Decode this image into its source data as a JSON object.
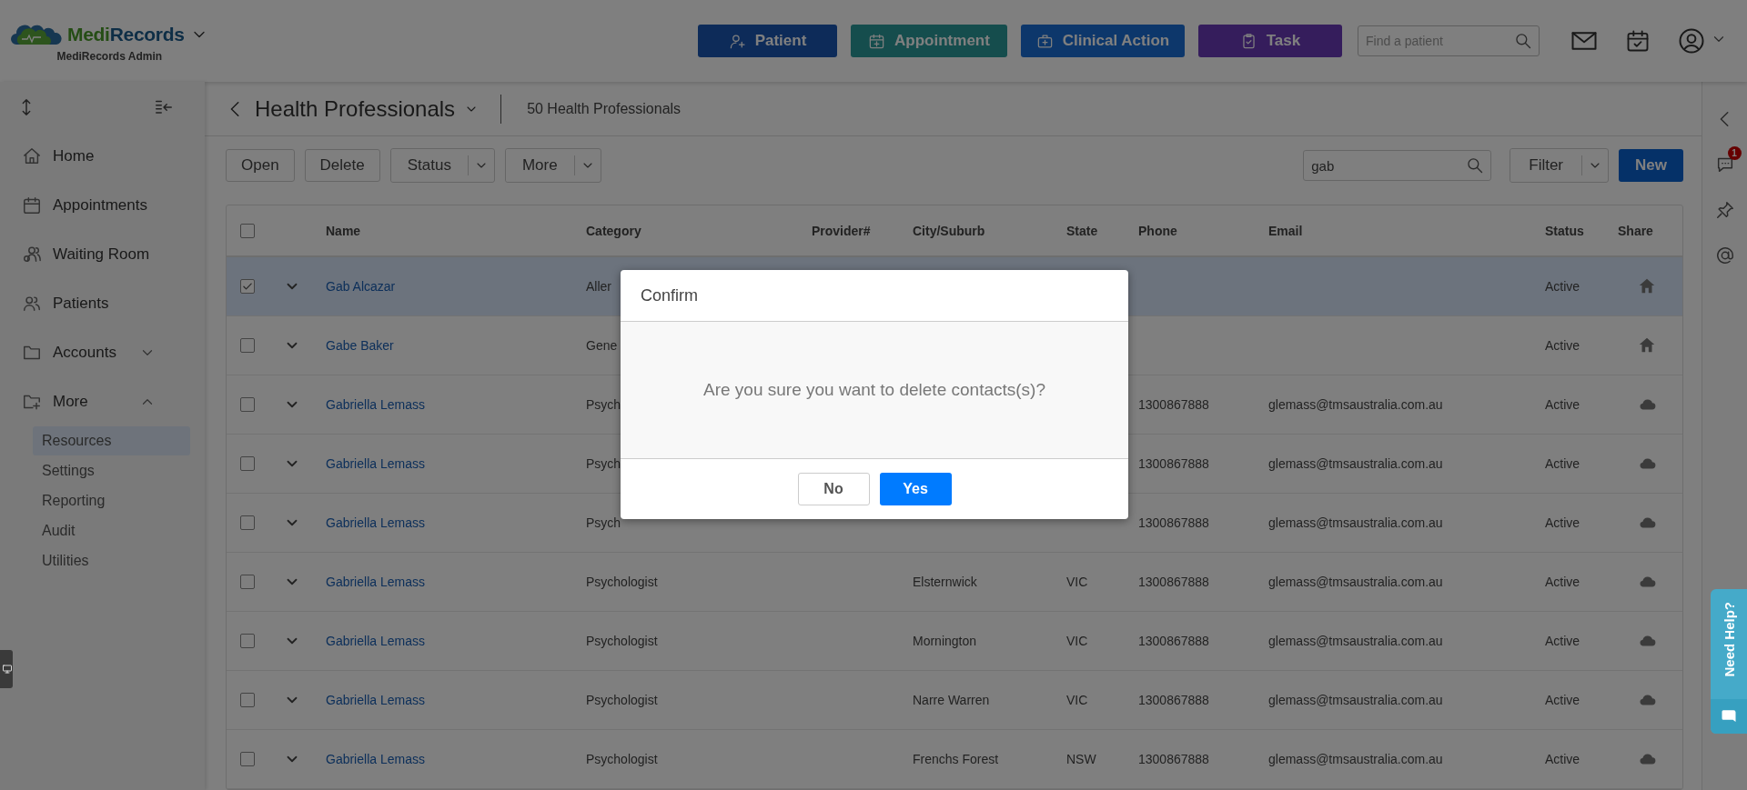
{
  "header": {
    "logo": {
      "part1": "Medi",
      "part2": "Records"
    },
    "org": "MediRecords Admin",
    "actions": [
      {
        "label": "Patient",
        "kind": "patient"
      },
      {
        "label": "Appointment",
        "kind": "appointment"
      },
      {
        "label": "Clinical Action",
        "kind": "clinical"
      },
      {
        "label": "Task",
        "kind": "task"
      }
    ],
    "search": {
      "placeholder": "Find a patient"
    }
  },
  "sidebar": {
    "items": [
      {
        "label": "Home",
        "selected": false
      },
      {
        "label": "Appointments",
        "selected": false
      },
      {
        "label": "Waiting Room",
        "selected": false
      },
      {
        "label": "Patients",
        "selected": false
      },
      {
        "label": "Accounts",
        "selected": false,
        "expanded": false
      },
      {
        "label": "More",
        "selected": false,
        "expanded": true,
        "children": [
          {
            "label": "Resources",
            "selected": true
          },
          {
            "label": "Settings",
            "selected": false
          },
          {
            "label": "Reporting",
            "selected": false
          },
          {
            "label": "Audit",
            "selected": false
          },
          {
            "label": "Utilities",
            "selected": false
          }
        ]
      }
    ]
  },
  "page": {
    "title": "Health Professionals",
    "count": "50 Health Professionals",
    "toolbar": [
      {
        "label": "Open",
        "kind": "plain"
      },
      {
        "label": "Delete",
        "kind": "plain"
      },
      {
        "label": "Status",
        "kind": "split"
      },
      {
        "label": "More",
        "kind": "split"
      }
    ],
    "search": {
      "value": "gab"
    },
    "filter": "Filter",
    "new_button": "New"
  },
  "table": {
    "select_all": {
      "checked": false
    },
    "columns": [
      "Name",
      "Category",
      "Provider#",
      "City/Suburb",
      "State",
      "Phone",
      "Email",
      "Status",
      "Share"
    ],
    "rows": [
      {
        "checked": true,
        "selected": true,
        "name": "Gab Alcazar",
        "category": "Aller",
        "status": "Active",
        "kind": "home"
      },
      {
        "checked": false,
        "selected": false,
        "name": "Gabe Baker",
        "category": "Gene",
        "status": "Active",
        "kind": "home"
      },
      {
        "checked": false,
        "selected": false,
        "name": "Gabriella Lemass",
        "category": "Psych",
        "phone": "1300867888",
        "email": "glemass@tmsaustralia.com.au",
        "status": "Active",
        "kind": "cloud"
      },
      {
        "checked": false,
        "selected": false,
        "name": "Gabriella Lemass",
        "category": "Psych",
        "phone": "1300867888",
        "email": "glemass@tmsaustralia.com.au",
        "status": "Active",
        "kind": "cloud"
      },
      {
        "checked": false,
        "selected": false,
        "name": "Gabriella Lemass",
        "category": "Psych",
        "phone": "1300867888",
        "email": "glemass@tmsaustralia.com.au",
        "status": "Active",
        "kind": "cloud"
      },
      {
        "checked": false,
        "selected": false,
        "name": "Gabriella Lemass",
        "category": "Psychologist",
        "city": "Elsternwick",
        "state": "VIC",
        "phone": "1300867888",
        "email": "glemass@tmsaustralia.com.au",
        "status": "Active",
        "kind": "cloud"
      },
      {
        "checked": false,
        "selected": false,
        "name": "Gabriella Lemass",
        "category": "Psychologist",
        "city": "Mornington",
        "state": "VIC",
        "phone": "1300867888",
        "email": "glemass@tmsaustralia.com.au",
        "status": "Active",
        "kind": "cloud"
      },
      {
        "checked": false,
        "selected": false,
        "name": "Gabriella Lemass",
        "category": "Psychologist",
        "city": "Narre Warren",
        "state": "VIC",
        "phone": "1300867888",
        "email": "glemass@tmsaustralia.com.au",
        "status": "Active",
        "kind": "cloud"
      },
      {
        "checked": false,
        "selected": false,
        "name": "Gabriella Lemass",
        "category": "Psychologist",
        "city": "Frenchs Forest",
        "state": "NSW",
        "phone": "1300867888",
        "email": "glemass@tmsaustralia.com.au",
        "status": "Active",
        "kind": "cloud"
      }
    ]
  },
  "rail": {
    "badge": "1"
  },
  "dialog": {
    "title": "Confirm",
    "message": "Are you sure you want to delete contacts(s)?",
    "buttons": [
      {
        "label": "No",
        "kind": "secondary"
      },
      {
        "label": "Yes",
        "kind": "primary"
      }
    ]
  },
  "help": {
    "label": "Need Help?"
  }
}
